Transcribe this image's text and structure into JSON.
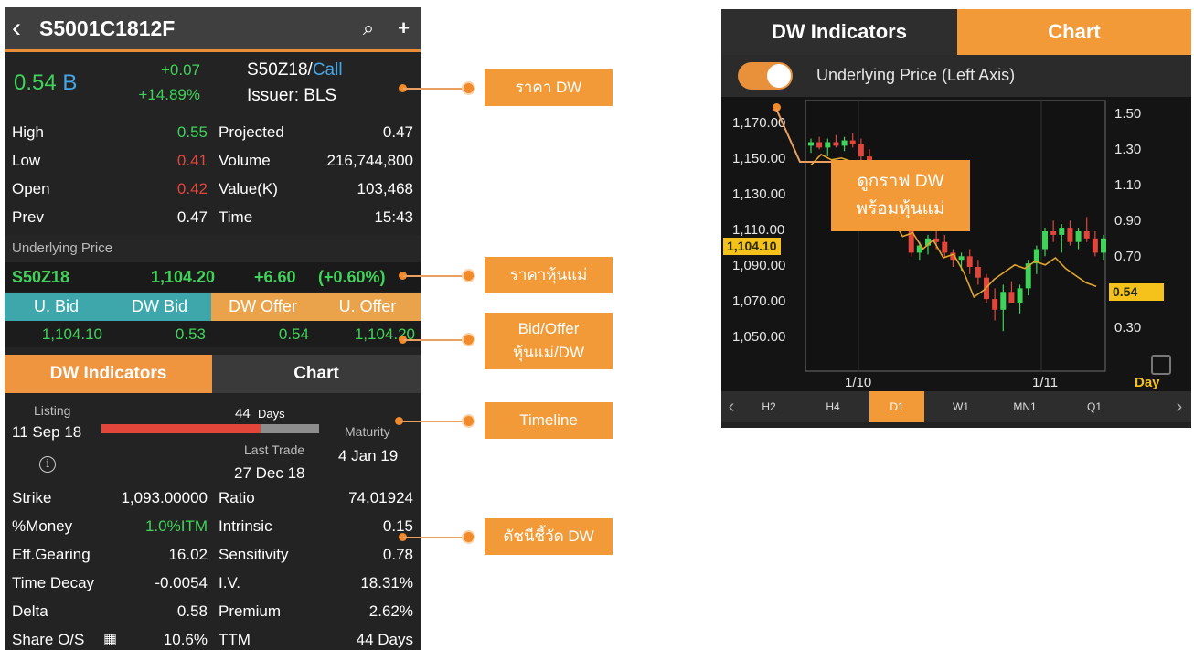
{
  "header": {
    "title": "S5001C1812F",
    "back_icon": "chevron-left-icon",
    "search_icon": "search-icon",
    "add_icon": "plus-icon"
  },
  "quote": {
    "price": "0.54",
    "unit": "B",
    "change": "+0.07",
    "change_pct": "+14.89%",
    "underlying_code": "S50Z18/",
    "option_type": "Call",
    "issuer": "Issuer: BLS",
    "rows": [
      {
        "label": "High",
        "value": "0.55",
        "color": "#3fd35a",
        "label2": "Projected",
        "value2": "0.47"
      },
      {
        "label": "Low",
        "value": "0.41",
        "color": "#e2453a",
        "label2": "Volume",
        "value2": "216,744,800"
      },
      {
        "label": "Open",
        "value": "0.42",
        "color": "#e2453a",
        "label2": "Value(K)",
        "value2": "103,468"
      },
      {
        "label": "Prev",
        "value": "0.47",
        "color": "#ffffff",
        "label2": "Time",
        "value2": "15:43"
      }
    ]
  },
  "underlying": {
    "title": "Underlying Price",
    "code": "S50Z18",
    "price": "1,104.20",
    "change": "+6.60",
    "change_pct": "(+0.60%)"
  },
  "bid_offer": {
    "headers": [
      "U. Bid",
      "DW Bid",
      "DW Offer",
      "U. Offer"
    ],
    "values": [
      "1,104.10",
      "0.53",
      "0.54",
      "1,104.20"
    ]
  },
  "tabs": {
    "indicators": "DW Indicators",
    "chart": "Chart"
  },
  "timeline": {
    "listing_label": "Listing",
    "listing_date": "11 Sep 18",
    "days": "44",
    "days_unit": "Days",
    "elapsed_fraction": 0.73,
    "maturity_label": "Maturity",
    "maturity_date": "4 Jan 19",
    "last_trade_label": "Last Trade",
    "last_trade_date": "27 Dec 18",
    "info_icon": "info-icon"
  },
  "indicators": [
    {
      "label": "Strike",
      "value": "1,093.00000",
      "color": "#ffffff",
      "label2": "Ratio",
      "value2": "74.01924"
    },
    {
      "label": "%Money",
      "value": "1.0%ITM",
      "color": "#3fd35a",
      "label2": "Intrinsic",
      "value2": "0.15"
    },
    {
      "label": "Eff.Gearing",
      "value": "16.02",
      "color": "#ffffff",
      "label2": "Sensitivity",
      "value2": "0.78"
    },
    {
      "label": "Time Decay",
      "value": "-0.0054",
      "color": "#ffffff",
      "label2": "I.V.",
      "value2": "18.31%"
    },
    {
      "label": "Delta",
      "value": "0.58",
      "color": "#ffffff",
      "label2": "Premium",
      "value2": "2.62%"
    },
    {
      "label": "Share O/S",
      "value": "10.6%",
      "color": "#ffffff",
      "label2": "TTM",
      "value2": "44 Days",
      "icon": "calendar-icon"
    }
  ],
  "callouts": {
    "dw_price": "ราคา DW",
    "underlying_price": "ราคาหุ้นแม่",
    "bid_offer_line1": "Bid/Offer",
    "bid_offer_line2": "หุ้นแม่/DW",
    "timeline": "Timeline",
    "indicators": "ดัชนีชี้วัด DW",
    "chart_line1": "ดูกราฟ DW",
    "chart_line2": "พร้อมหุ้นแม่"
  },
  "chart_panel": {
    "tab_indicators": "DW Indicators",
    "tab_chart": "Chart",
    "toggle_label": "Underlying Price (Left Axis)",
    "toggle_on": true,
    "left_axis": [
      "1,170.00",
      "1,150.00",
      "1,130.00",
      "1,110.00",
      "1,090.00",
      "1,070.00",
      "1,050.00"
    ],
    "right_axis": [
      "1.50",
      "1.30",
      "1.10",
      "0.90",
      "0.70",
      "0.50",
      "0.30"
    ],
    "left_tag": "1,104.10",
    "right_tag": "0.54",
    "x_labels": [
      "1/10",
      "1/11"
    ],
    "period_label": "Day",
    "timeframes": [
      "H2",
      "H4",
      "D1",
      "W1",
      "MN1",
      "Q1"
    ],
    "active_timeframe": "D1",
    "colors": {
      "up": "#3fd35a",
      "down": "#e2453a",
      "line": "#e0a52c",
      "accent": "#f29a38"
    }
  },
  "chart_data": {
    "type": "line",
    "x_labels": [
      "1/10",
      "1/11"
    ],
    "left_axis": {
      "label": "",
      "ylim": [
        1050,
        1170
      ],
      "ticks": [
        "1,170.00",
        "1,150.00",
        "1,130.00",
        "1,110.00",
        "1,090.00",
        "1,070.00",
        "1,050.00"
      ]
    },
    "right_axis": {
      "ylim": [
        0.3,
        1.5
      ],
      "ticks": [
        "1.50",
        "1.30",
        "1.10",
        "0.90",
        "0.70",
        "0.50",
        "0.30"
      ]
    },
    "candles": [
      [
        1158,
        1162,
        1154,
        1160
      ],
      [
        1160,
        1163,
        1156,
        1157
      ],
      [
        1157,
        1162,
        1152,
        1160
      ],
      [
        1160,
        1164,
        1157,
        1158
      ],
      [
        1158,
        1163,
        1155,
        1161
      ],
      [
        1161,
        1165,
        1157,
        1159
      ],
      [
        1159,
        1162,
        1150,
        1152
      ],
      [
        1152,
        1156,
        1144,
        1146
      ],
      [
        1146,
        1150,
        1140,
        1148
      ],
      [
        1148,
        1150,
        1132,
        1134
      ],
      [
        1134,
        1138,
        1118,
        1120
      ],
      [
        1120,
        1126,
        1110,
        1124
      ],
      [
        1124,
        1128,
        1096,
        1098
      ],
      [
        1098,
        1104,
        1094,
        1102
      ],
      [
        1102,
        1108,
        1097,
        1106
      ],
      [
        1106,
        1112,
        1100,
        1104
      ],
      [
        1104,
        1108,
        1095,
        1098
      ],
      [
        1098,
        1100,
        1090,
        1094
      ],
      [
        1094,
        1098,
        1088,
        1096
      ],
      [
        1096,
        1100,
        1086,
        1090
      ],
      [
        1090,
        1094,
        1080,
        1084
      ],
      [
        1084,
        1086,
        1070,
        1072
      ],
      [
        1072,
        1078,
        1060,
        1066
      ],
      [
        1066,
        1080,
        1054,
        1076
      ],
      [
        1076,
        1082,
        1072,
        1070
      ],
      [
        1070,
        1080,
        1064,
        1078
      ],
      [
        1078,
        1094,
        1074,
        1092
      ],
      [
        1092,
        1102,
        1086,
        1100
      ],
      [
        1100,
        1112,
        1096,
        1110
      ],
      [
        1110,
        1116,
        1104,
        1108
      ],
      [
        1108,
        1114,
        1098,
        1112
      ],
      [
        1112,
        1116,
        1102,
        1104
      ],
      [
        1104,
        1112,
        1100,
        1110
      ],
      [
        1110,
        1118,
        1104,
        1106
      ],
      [
        1106,
        1110,
        1096,
        1098
      ],
      [
        1098,
        1108,
        1094,
        1106
      ]
    ],
    "series": [
      {
        "axis": "right",
        "values": [
          1.22,
          1.28,
          1.25,
          1.26,
          1.24,
          1.2,
          1.1,
          0.95,
          0.92,
          0.82,
          0.84,
          0.75,
          0.8,
          0.7,
          0.72,
          0.62,
          0.48,
          0.52,
          0.58,
          0.62,
          0.66,
          0.64,
          0.68,
          0.66,
          0.7,
          0.64,
          0.6,
          0.56,
          0.54
        ]
      }
    ]
  }
}
